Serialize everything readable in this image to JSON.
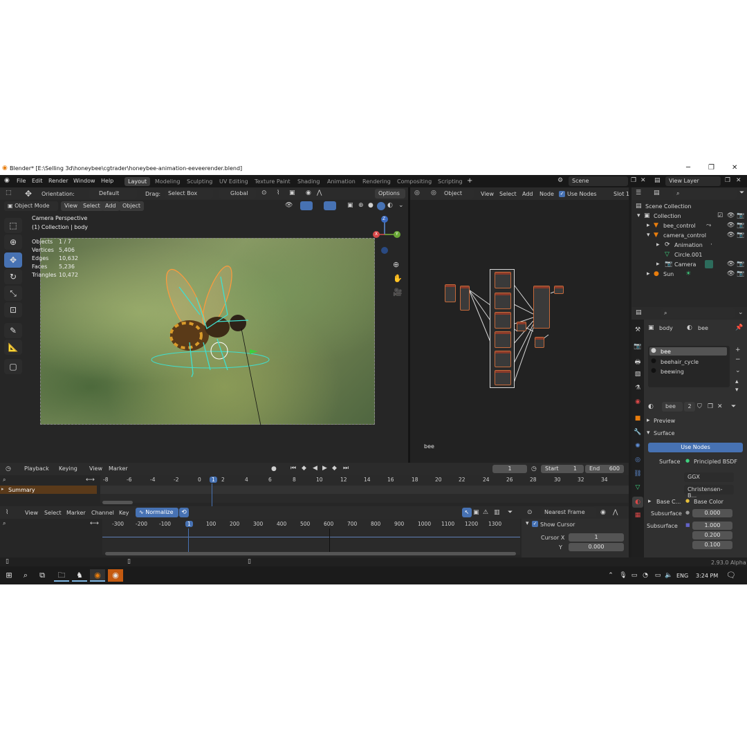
{
  "window": {
    "title": "Blender* [E:\\Selling 3d\\honeybee\\cgtrader\\honeybee-animation-eeveerender.blend]",
    "minimize": "─",
    "maximize": "❐",
    "close": "✕"
  },
  "menu": {
    "items": [
      "File",
      "Edit",
      "Render",
      "Window",
      "Help"
    ]
  },
  "workspaces": {
    "tabs": [
      "Layout",
      "Modeling",
      "Sculpting",
      "UV Editing",
      "Texture Paint",
      "Shading",
      "Animation",
      "Rendering",
      "Compositing",
      "Scripting"
    ],
    "active": "Layout",
    "add": "+"
  },
  "scene": {
    "name": "Scene",
    "view_layer": "View Layer"
  },
  "tool_header": {
    "orientation_label": "Orientation:",
    "orientation_value": "Default",
    "drag_label": "Drag:",
    "drag_value": "Select Box",
    "transform": "Global",
    "options": "Options"
  },
  "viewport_header": {
    "mode": "Object Mode",
    "view": "View",
    "select": "Select",
    "add": "Add",
    "object": "Object"
  },
  "viewport": {
    "title": "Camera Perspective",
    "subtitle": "(1) Collection | body",
    "stats": [
      {
        "label": "Objects",
        "value": "1 / 7"
      },
      {
        "label": "Vertices",
        "value": "5,406"
      },
      {
        "label": "Edges",
        "value": "10,632"
      },
      {
        "label": "Faces",
        "value": "5,236"
      },
      {
        "label": "Triangles",
        "value": "10,472"
      }
    ],
    "gizmo": {
      "z": "Z",
      "y": "Y",
      "x": "X"
    }
  },
  "node_editor": {
    "type": "Object",
    "view": "View",
    "select": "Select",
    "add": "Add",
    "node": "Node",
    "use_nodes": "Use Nodes",
    "slot": "Slot 1",
    "material_label": "bee"
  },
  "outliner": {
    "root": "Scene Collection",
    "items": [
      {
        "label": "Collection",
        "indent": 1
      },
      {
        "label": "bee_control",
        "indent": 2
      },
      {
        "label": "camera_control",
        "indent": 2
      },
      {
        "label": "Animation",
        "indent": 3
      },
      {
        "label": "Circle.001",
        "indent": 3
      },
      {
        "label": "Camera",
        "indent": 2
      },
      {
        "label": "Sun",
        "indent": 1
      }
    ]
  },
  "properties": {
    "breadcrumb_object": "body",
    "breadcrumb_material": "bee",
    "slots": [
      "bee",
      "beehair_cycle",
      "beewing"
    ],
    "material_name": "bee",
    "users": "2",
    "preview": "Preview",
    "surface_panel": "Surface",
    "use_nodes": "Use Nodes",
    "surface_label": "Surface",
    "surface_value": "Principled BSDF",
    "distribution": "GGX",
    "subsurface_method": "Christensen-B...",
    "base_color_label": "Base C...",
    "base_color_value": "Base Color",
    "subsurface_label": "Subsurface",
    "subsurface_value": "0.000",
    "subsurface_radius_label": "Subsurface",
    "subsurface_radius": [
      "1.000",
      "0.200",
      "0.100"
    ]
  },
  "timeline": {
    "playback": "Playback",
    "keying": "Keying",
    "view": "View",
    "marker": "Marker",
    "current_frame": "1",
    "start_label": "Start",
    "start": "1",
    "end_label": "End",
    "end": "600",
    "summary": "Summary",
    "ticks": [
      "-8",
      "-6",
      "-4",
      "-2",
      "0",
      "1",
      "2",
      "4",
      "6",
      "8",
      "10",
      "12",
      "14",
      "16",
      "18",
      "20",
      "22",
      "24",
      "26",
      "28",
      "30",
      "32",
      "34"
    ]
  },
  "graph_editor": {
    "view": "View",
    "select": "Select",
    "marker": "Marker",
    "channel": "Channel",
    "key": "Key",
    "normalize": "Normalize",
    "snap": "Nearest Frame",
    "ticks": [
      "-300",
      "-200",
      "-100",
      "1",
      "100",
      "200",
      "300",
      "400",
      "500",
      "600",
      "700",
      "800",
      "900",
      "1000",
      "1100",
      "1200",
      "1300"
    ],
    "show_cursor": "Show Cursor",
    "cursor_x_label": "Cursor X",
    "cursor_x": "1",
    "cursor_y_label": "Y",
    "cursor_y": "0.000"
  },
  "status": {
    "version": "2.93.0 Alpha"
  },
  "taskbar": {
    "lang": "ENG",
    "time": "3:24 PM"
  }
}
